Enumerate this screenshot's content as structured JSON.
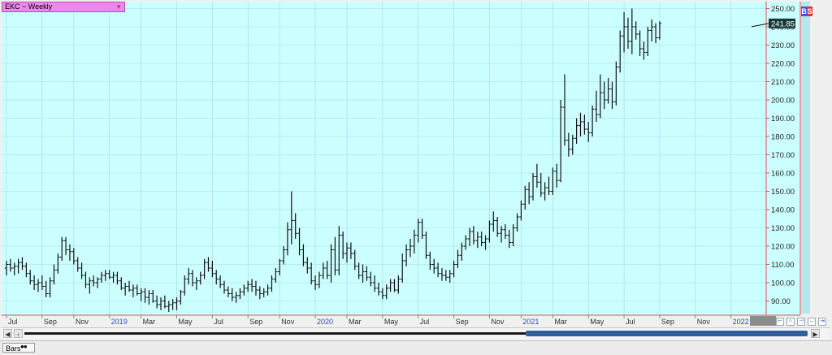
{
  "symbol": {
    "label": "EKC ~ Weekly",
    "dropdown_icon": "triangle-down-icon"
  },
  "flags": {
    "left": "B",
    "right": "S",
    "left_color": "#3a5ad8",
    "right_color": "#e03030"
  },
  "colors": {
    "plot_bg": "#ccffff",
    "grid": "#9fd8e0",
    "axis_line": "#e05050",
    "bars": "#111111",
    "last_price_bg": "#1a3a3a",
    "grey_block": "#8c8c8c"
  },
  "bottom": {
    "tab_label": "Bars"
  },
  "scroll": {
    "left_icon": "arrow-left-icon",
    "right_icon": "arrow-right-icon"
  },
  "chart_data": {
    "type": "ohlc",
    "title": "EKC ~ Weekly",
    "last_price": "241.85",
    "y_ticks": [
      "250.00",
      "240.00",
      "230.00",
      "220.00",
      "210.00",
      "200.00",
      "190.00",
      "180.00",
      "170.00",
      "160.00",
      "150.00",
      "140.00",
      "130.00",
      "120.00",
      "110.00",
      "100.00",
      "90.00"
    ],
    "ylim": [
      84,
      252
    ],
    "x_ticks": [
      {
        "label": "Jul",
        "week": 0,
        "year": false
      },
      {
        "label": "Sep",
        "week": 9,
        "year": false
      },
      {
        "label": "Nov",
        "week": 17,
        "year": false
      },
      {
        "label": "2019",
        "week": 26,
        "year": true
      },
      {
        "label": "Mar",
        "week": 34,
        "year": false
      },
      {
        "label": "May",
        "week": 43,
        "year": false
      },
      {
        "label": "Jul",
        "week": 52,
        "year": false
      },
      {
        "label": "Sep",
        "week": 61,
        "year": false
      },
      {
        "label": "Nov",
        "week": 69,
        "year": false
      },
      {
        "label": "2020",
        "week": 78,
        "year": true
      },
      {
        "label": "Mar",
        "week": 86,
        "year": false
      },
      {
        "label": "May",
        "week": 95,
        "year": false
      },
      {
        "label": "Jul",
        "week": 104,
        "year": false
      },
      {
        "label": "Sep",
        "week": 113,
        "year": false
      },
      {
        "label": "Nov",
        "week": 122,
        "year": false
      },
      {
        "label": "2021",
        "week": 130,
        "year": true
      },
      {
        "label": "Mar",
        "week": 138,
        "year": false
      },
      {
        "label": "May",
        "week": 147,
        "year": false
      },
      {
        "label": "Jul",
        "week": 156,
        "year": false
      },
      {
        "label": "Sep",
        "week": 165,
        "year": false
      },
      {
        "label": "Nov",
        "week": 174,
        "year": false
      },
      {
        "label": "2022",
        "week": 183,
        "year": true
      }
    ],
    "x_range": [
      0,
      188
    ],
    "bars": [
      [
        108,
        112,
        104,
        110
      ],
      [
        110,
        113,
        106,
        108
      ],
      [
        108,
        111,
        104,
        109
      ],
      [
        109,
        113,
        105,
        111
      ],
      [
        111,
        114,
        107,
        109
      ],
      [
        109,
        111,
        103,
        105
      ],
      [
        105,
        107,
        99,
        101
      ],
      [
        101,
        104,
        96,
        99
      ],
      [
        99,
        102,
        95,
        100
      ],
      [
        100,
        104,
        96,
        98
      ],
      [
        98,
        101,
        92,
        94
      ],
      [
        94,
        103,
        92,
        101
      ],
      [
        101,
        110,
        99,
        107
      ],
      [
        107,
        116,
        105,
        114
      ],
      [
        114,
        125,
        112,
        123
      ],
      [
        123,
        125,
        115,
        118
      ],
      [
        118,
        121,
        112,
        117
      ],
      [
        117,
        119,
        110,
        112
      ],
      [
        112,
        114,
        106,
        108
      ],
      [
        108,
        111,
        102,
        104
      ],
      [
        104,
        106,
        97,
        99
      ],
      [
        99,
        103,
        94,
        101
      ],
      [
        101,
        104,
        98,
        100
      ],
      [
        100,
        103,
        97,
        102
      ],
      [
        102,
        106,
        100,
        104
      ],
      [
        104,
        107,
        101,
        105
      ],
      [
        105,
        107,
        102,
        103
      ],
      [
        103,
        106,
        100,
        104
      ],
      [
        104,
        106,
        99,
        101
      ],
      [
        101,
        103,
        96,
        97
      ],
      [
        97,
        100,
        93,
        98
      ],
      [
        98,
        101,
        95,
        96
      ],
      [
        96,
        99,
        92,
        97
      ],
      [
        97,
        99,
        93,
        94
      ],
      [
        94,
        97,
        90,
        95
      ],
      [
        95,
        97,
        89,
        92
      ],
      [
        92,
        96,
        88,
        94
      ],
      [
        94,
        96,
        89,
        90
      ],
      [
        90,
        93,
        86,
        88
      ],
      [
        88,
        92,
        85,
        90
      ],
      [
        90,
        93,
        86,
        87
      ],
      [
        87,
        90,
        84,
        88
      ],
      [
        88,
        91,
        85,
        89
      ],
      [
        89,
        92,
        85,
        90
      ],
      [
        90,
        96,
        88,
        95
      ],
      [
        95,
        104,
        93,
        102
      ],
      [
        102,
        108,
        99,
        105
      ],
      [
        105,
        107,
        98,
        100
      ],
      [
        100,
        103,
        96,
        101
      ],
      [
        101,
        106,
        99,
        104
      ],
      [
        104,
        113,
        102,
        111
      ],
      [
        111,
        114,
        106,
        108
      ],
      [
        108,
        112,
        103,
        105
      ],
      [
        105,
        107,
        99,
        102
      ],
      [
        102,
        104,
        97,
        99
      ],
      [
        99,
        101,
        94,
        96
      ],
      [
        96,
        98,
        92,
        94
      ],
      [
        94,
        97,
        90,
        92
      ],
      [
        92,
        95,
        89,
        93
      ],
      [
        93,
        97,
        91,
        95
      ],
      [
        95,
        99,
        93,
        97
      ],
      [
        97,
        101,
        95,
        99
      ],
      [
        99,
        102,
        95,
        98
      ],
      [
        98,
        101,
        93,
        96
      ],
      [
        96,
        98,
        91,
        94
      ],
      [
        94,
        97,
        92,
        95
      ],
      [
        95,
        99,
        93,
        97
      ],
      [
        97,
        104,
        95,
        102
      ],
      [
        102,
        108,
        100,
        106
      ],
      [
        106,
        113,
        104,
        112
      ],
      [
        112,
        120,
        110,
        118
      ],
      [
        118,
        133,
        115,
        129
      ],
      [
        129,
        150,
        121,
        134
      ],
      [
        134,
        138,
        124,
        127
      ],
      [
        127,
        130,
        115,
        118
      ],
      [
        118,
        121,
        109,
        111
      ],
      [
        111,
        114,
        105,
        108
      ],
      [
        108,
        111,
        99,
        101
      ],
      [
        101,
        104,
        96,
        99
      ],
      [
        99,
        106,
        97,
        104
      ],
      [
        104,
        111,
        102,
        108
      ],
      [
        108,
        112,
        102,
        104
      ],
      [
        104,
        121,
        100,
        118
      ],
      [
        118,
        125,
        104,
        107
      ],
      [
        107,
        131,
        104,
        126
      ],
      [
        126,
        128,
        113,
        116
      ],
      [
        116,
        122,
        111,
        119
      ],
      [
        119,
        122,
        113,
        116
      ],
      [
        116,
        118,
        107,
        109
      ],
      [
        109,
        111,
        102,
        104
      ],
      [
        104,
        110,
        100,
        106
      ],
      [
        106,
        109,
        101,
        103
      ],
      [
        103,
        106,
        98,
        100
      ],
      [
        100,
        104,
        95,
        97
      ],
      [
        97,
        100,
        93,
        95
      ],
      [
        95,
        97,
        91,
        93
      ],
      [
        93,
        99,
        91,
        97
      ],
      [
        97,
        102,
        95,
        100
      ],
      [
        100,
        102,
        95,
        96
      ],
      [
        96,
        104,
        94,
        102
      ],
      [
        102,
        116,
        100,
        112
      ],
      [
        112,
        121,
        109,
        118
      ],
      [
        118,
        124,
        114,
        120
      ],
      [
        120,
        129,
        116,
        126
      ],
      [
        126,
        135,
        122,
        133
      ],
      [
        133,
        135,
        124,
        126
      ],
      [
        126,
        128,
        113,
        115
      ],
      [
        115,
        117,
        107,
        110
      ],
      [
        110,
        113,
        105,
        108
      ],
      [
        108,
        111,
        103,
        105
      ],
      [
        105,
        108,
        101,
        104
      ],
      [
        104,
        107,
        101,
        103
      ],
      [
        103,
        107,
        100,
        105
      ],
      [
        105,
        112,
        103,
        110
      ],
      [
        110,
        118,
        108,
        115
      ],
      [
        115,
        122,
        112,
        120
      ],
      [
        120,
        126,
        118,
        124
      ],
      [
        124,
        130,
        120,
        128
      ],
      [
        128,
        131,
        121,
        123
      ],
      [
        123,
        128,
        119,
        125
      ],
      [
        125,
        128,
        120,
        122
      ],
      [
        122,
        126,
        118,
        124
      ],
      [
        124,
        134,
        122,
        132
      ],
      [
        132,
        139,
        128,
        134
      ],
      [
        134,
        136,
        125,
        127
      ],
      [
        127,
        131,
        122,
        129
      ],
      [
        129,
        132,
        124,
        126
      ],
      [
        126,
        129,
        119,
        122
      ],
      [
        122,
        132,
        120,
        130
      ],
      [
        130,
        138,
        128,
        136
      ],
      [
        136,
        145,
        134,
        143
      ],
      [
        143,
        153,
        140,
        151
      ],
      [
        151,
        155,
        143,
        147
      ],
      [
        147,
        160,
        145,
        158
      ],
      [
        158,
        165,
        152,
        155
      ],
      [
        155,
        160,
        147,
        149
      ],
      [
        149,
        155,
        145,
        152
      ],
      [
        152,
        158,
        148,
        150
      ],
      [
        150,
        163,
        148,
        161
      ],
      [
        161,
        165,
        152,
        156
      ],
      [
        156,
        200,
        155,
        196
      ],
      [
        196,
        214,
        175,
        178
      ],
      [
        178,
        182,
        169,
        173
      ],
      [
        173,
        181,
        170,
        179
      ],
      [
        179,
        190,
        176,
        186
      ],
      [
        186,
        193,
        180,
        188
      ],
      [
        188,
        192,
        181,
        184
      ],
      [
        184,
        188,
        177,
        182
      ],
      [
        182,
        197,
        180,
        195
      ],
      [
        195,
        205,
        188,
        192
      ],
      [
        192,
        214,
        190,
        204
      ],
      [
        204,
        210,
        195,
        200
      ],
      [
        200,
        212,
        198,
        206
      ],
      [
        206,
        210,
        195,
        199
      ],
      [
        199,
        221,
        197,
        218
      ],
      [
        218,
        238,
        215,
        235
      ],
      [
        235,
        248,
        226,
        240
      ],
      [
        240,
        245,
        228,
        232
      ],
      [
        232,
        250,
        225,
        240
      ],
      [
        240,
        243,
        233,
        236
      ],
      [
        236,
        238,
        224,
        228
      ],
      [
        228,
        232,
        222,
        226
      ],
      [
        226,
        240,
        224,
        238
      ],
      [
        238,
        244,
        232,
        240
      ],
      [
        240,
        242,
        231,
        234
      ],
      [
        234,
        243,
        233,
        241.85
      ]
    ]
  }
}
